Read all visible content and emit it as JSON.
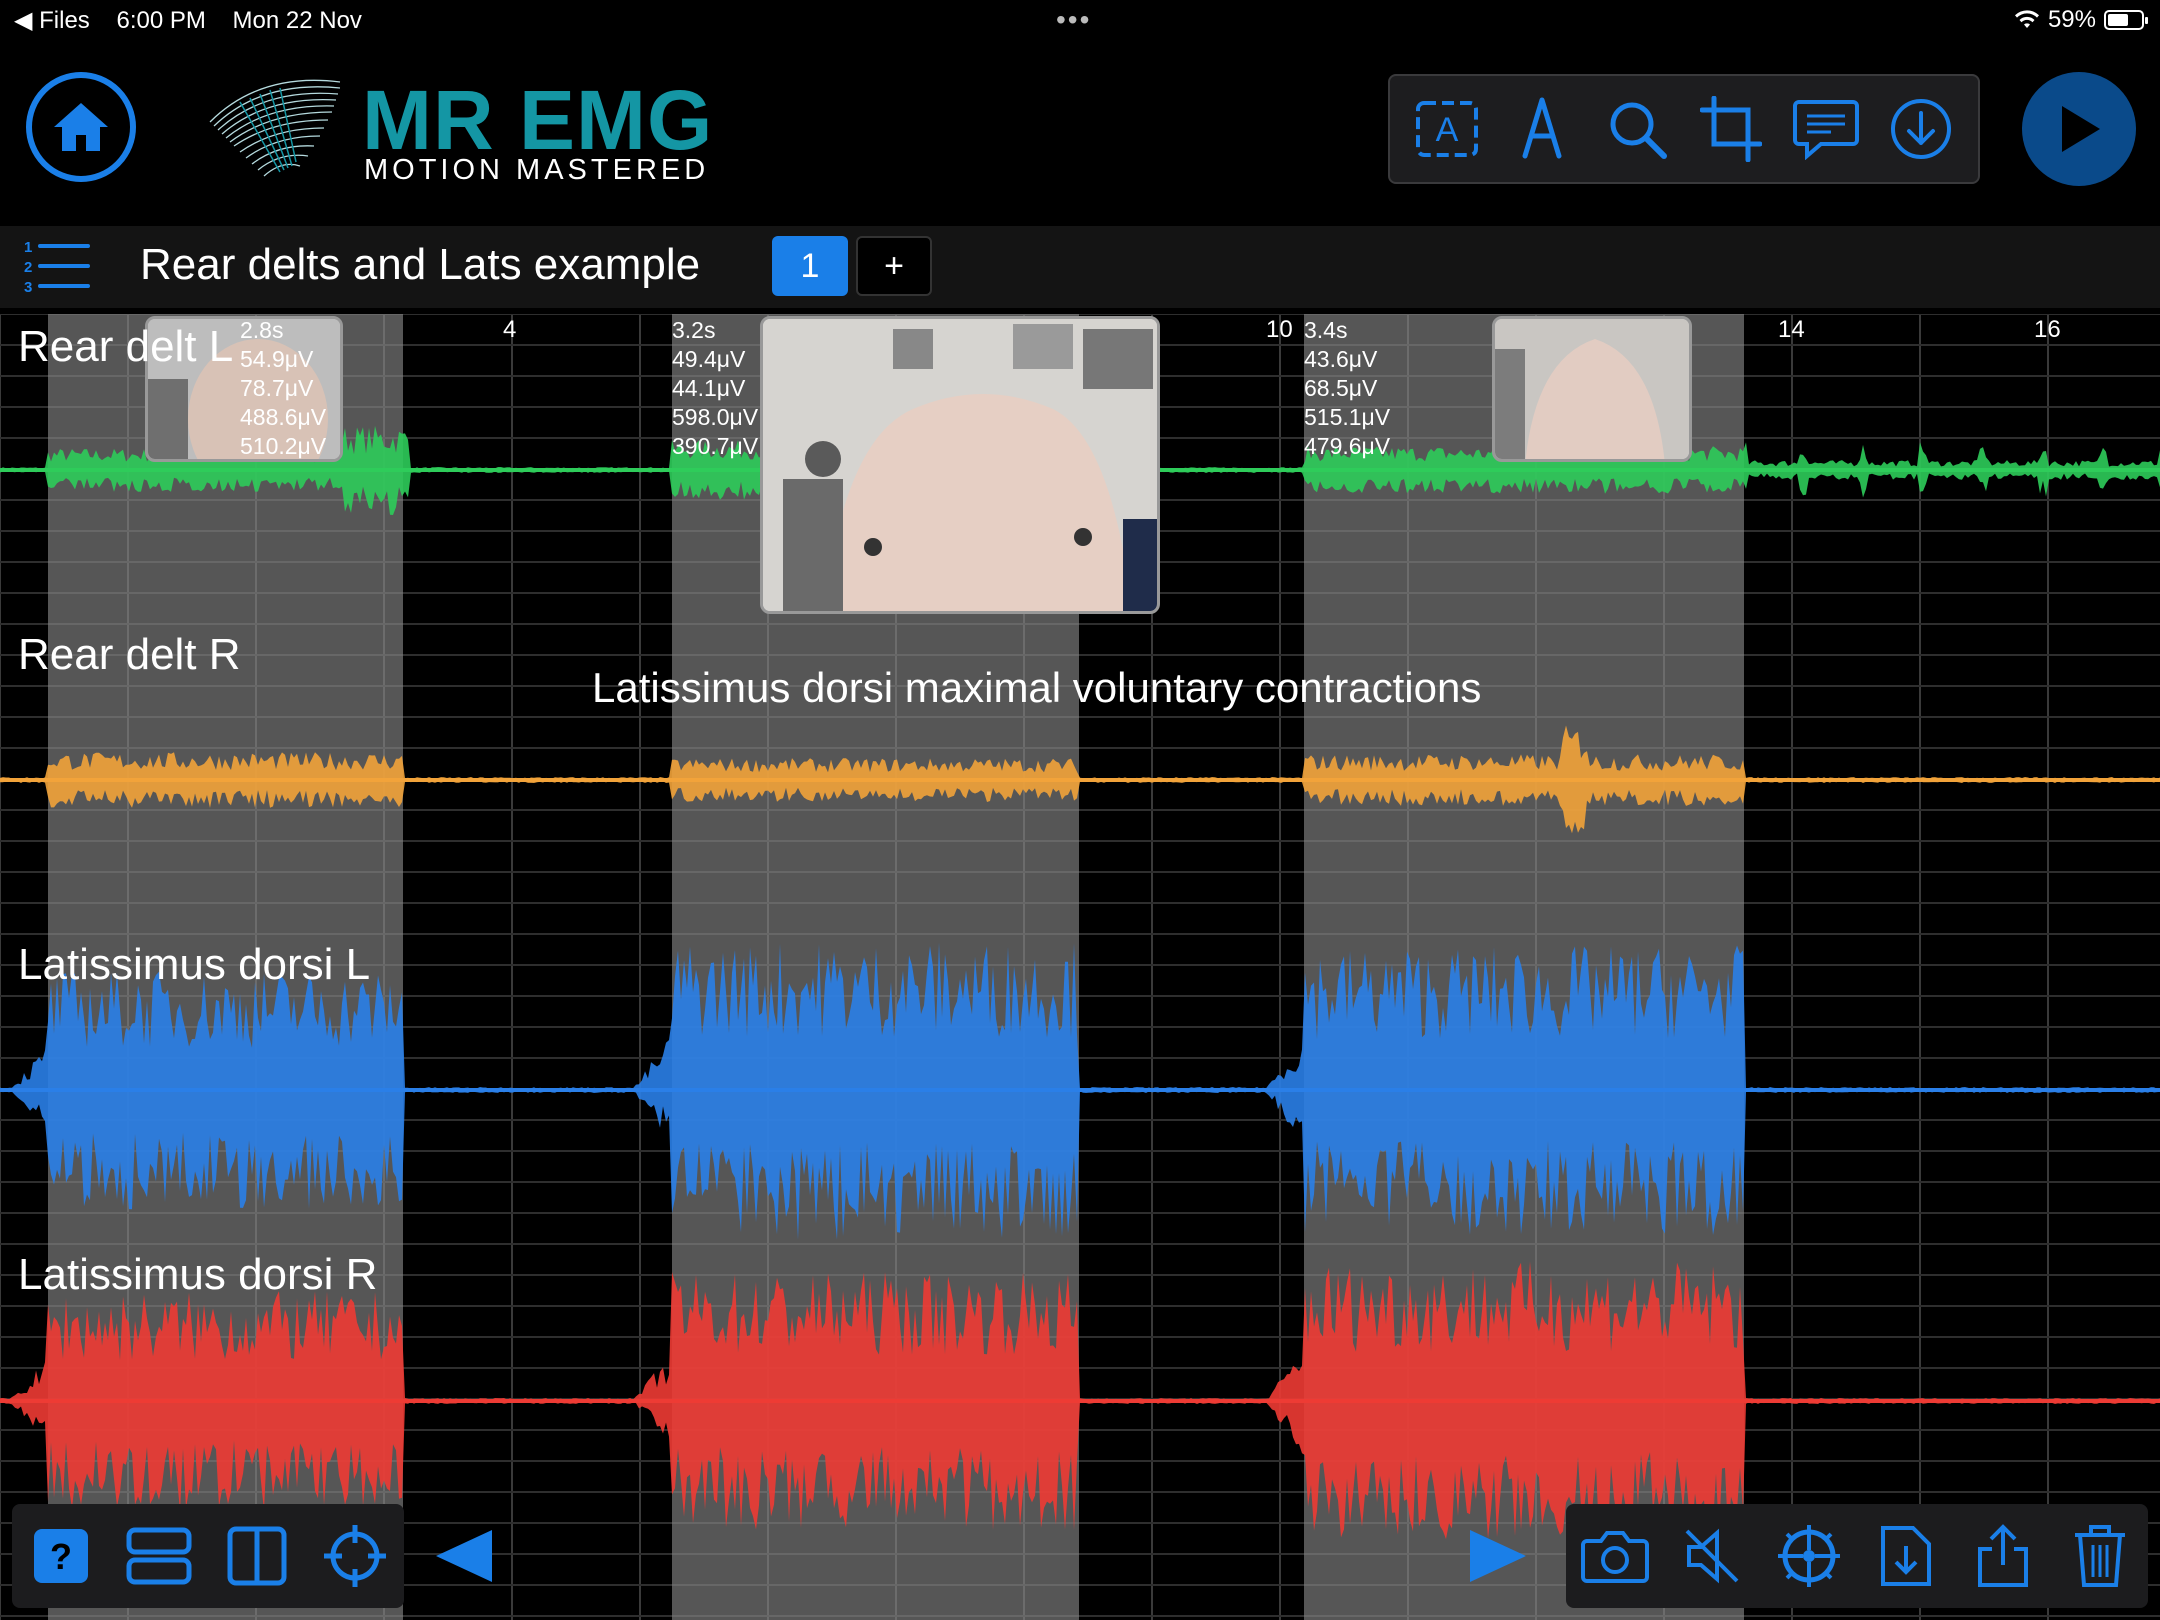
{
  "status_bar": {
    "back_app": "◀ Files",
    "time": "6:00 PM",
    "date": "Mon 22 Nov",
    "dots": "•••",
    "battery": "59%",
    "battery_level": 0.59
  },
  "logo": {
    "title": "MR EMG",
    "subtitle": "MOTION MASTERED"
  },
  "toolbar": {
    "icons": [
      "text-box-icon",
      "pen-icon",
      "search-icon",
      "crop-icon",
      "comment-icon",
      "download-icon"
    ]
  },
  "recording": {
    "title": "Rear delts and Lats example",
    "tabs": [
      "1"
    ],
    "add_tab": "+"
  },
  "colors": {
    "accent": "#1a7fe8",
    "brand": "#1496a4",
    "rear_delt_l": "#2ecc5a",
    "rear_delt_r": "#f2a33a",
    "lat_l": "#2a7fe8",
    "lat_r": "#ee3b34"
  },
  "chart_data": {
    "type": "line",
    "title": "",
    "x_ticks": [
      "4",
      "10",
      "14",
      "16"
    ],
    "channels": [
      {
        "name": "Rear delt L",
        "color": "#2ecc5a"
      },
      {
        "name": "Rear delt R",
        "color": "#f2a33a"
      },
      {
        "name": "Latissimus dorsi L",
        "color": "#2a7fe8"
      },
      {
        "name": "Latissimus dorsi R",
        "color": "#ee3b34"
      }
    ],
    "selections": [
      {
        "duration": "2.8s",
        "values": [
          "54.9μV",
          "78.7μV",
          "488.6μV",
          "510.2μV"
        ]
      },
      {
        "duration": "3.2s",
        "values": [
          "49.4μV",
          "44.1μV",
          "598.0μV",
          "390.7μV"
        ]
      },
      {
        "duration": "3.4s",
        "values": [
          "43.6μV",
          "68.5μV",
          "515.1μV",
          "479.6μV"
        ]
      }
    ],
    "annotation": "Latissimus dorsi maximal voluntary contractions"
  },
  "bottom_left": {
    "icons": [
      "help-icon",
      "stack-layout-icon",
      "split-layout-icon",
      "crosshair-icon"
    ],
    "prev": "previous-arrow-icon"
  },
  "bottom_right": {
    "next": "next-arrow-icon",
    "icons": [
      "camera-icon",
      "mute-icon",
      "settings-wheel-icon",
      "file-import-icon",
      "share-icon",
      "trash-icon"
    ]
  }
}
